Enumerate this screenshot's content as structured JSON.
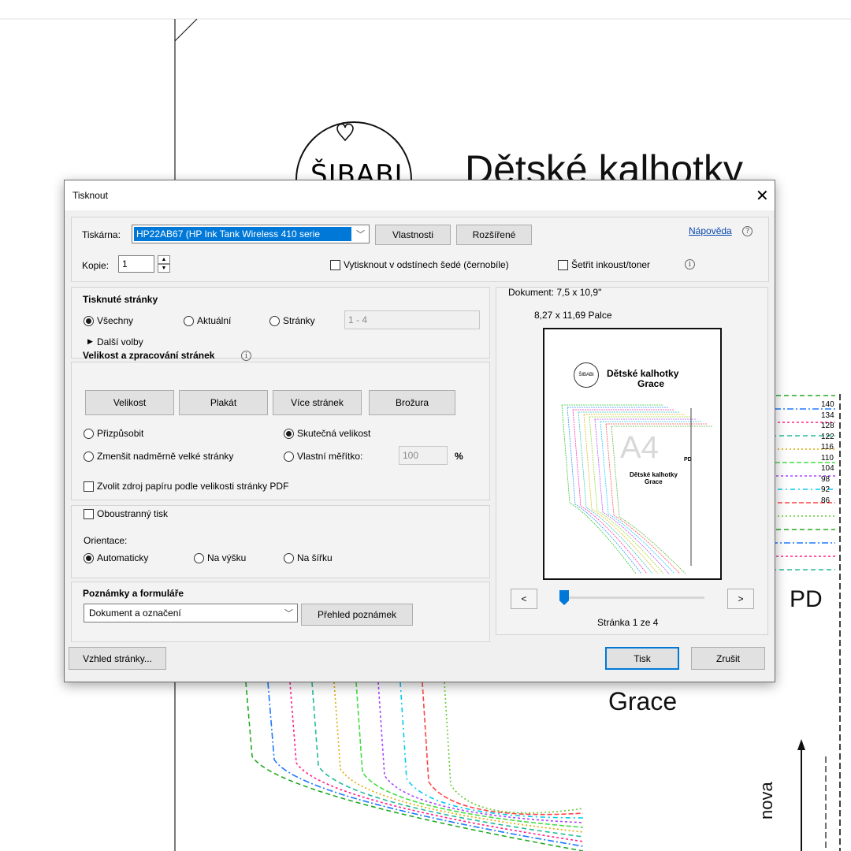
{
  "background": {
    "logo_text": "ŠIBABI",
    "doc_title_line1": "Dětské kalhotky",
    "doc_title_line2": "Grace",
    "pd_label": "PD",
    "vertical_text": "nova",
    "size_labels": [
      "140",
      "134",
      "128",
      "122",
      "116",
      "110",
      "104",
      "98",
      "92",
      "86"
    ]
  },
  "dialog": {
    "title": "Tisknout",
    "printer_label": "Tiskárna:",
    "printer_value": "HP22AB67 (HP Ink Tank Wireless 410 serie",
    "properties_button": "Vlastnosti",
    "advanced_button": "Rozšířené",
    "help_link": "Nápověda",
    "copies_label": "Kopie:",
    "copies_value": "1",
    "grayscale_label": "Vytisknout v odstínech šedé (černobíle)",
    "save_ink_label": "Šetřit inkoust/toner",
    "pages_section": {
      "title": "Tisknuté stránky",
      "all": "Všechny",
      "current": "Aktuální",
      "pages": "Stránky",
      "range_value": "1 - 4",
      "more_options": "Další volby"
    },
    "size_section": {
      "title": "Velikost a zpracování stránek",
      "tabs": [
        "Velikost",
        "Plakát",
        "Více stránek",
        "Brožura"
      ],
      "fit": "Přizpůsobit",
      "actual_size": "Skutečná velikost",
      "shrink": "Zmenšit nadměrně velké stránky",
      "custom_scale": "Vlastní měřítko:",
      "scale_value": "100",
      "percent": "%",
      "paper_source": "Zvolit zdroj papíru podle velikosti stránky PDF"
    },
    "duplex_label": "Oboustranný tisk",
    "orientation": {
      "label": "Orientace:",
      "auto": "Automaticky",
      "portrait": "Na výšku",
      "landscape": "Na šířku"
    },
    "comments": {
      "title": "Poznámky a formuláře",
      "value": "Dokument a označení",
      "summary_button": "Přehled poznámek"
    },
    "preview": {
      "doc_size": "Dokument: 7,5 x 10,9\"",
      "paper_size": "8,27 x 11,69 Palce",
      "thumb_title_line1": "Dětské kalhotky",
      "thumb_title_line2": "Grace",
      "thumb_logo": "ŠIBABI",
      "thumb_pd": "PD",
      "thumb_title2_line1": "Dětské kalhotky",
      "thumb_title2_line2": "Grace",
      "thumb_watermark": "A4",
      "prev": "<",
      "next": ">",
      "page_status": "Stránka 1 ze 4",
      "page_position": 0.0
    },
    "page_setup_button": "Vzhled stránky...",
    "print_button": "Tisk",
    "cancel_button": "Zrušit"
  }
}
